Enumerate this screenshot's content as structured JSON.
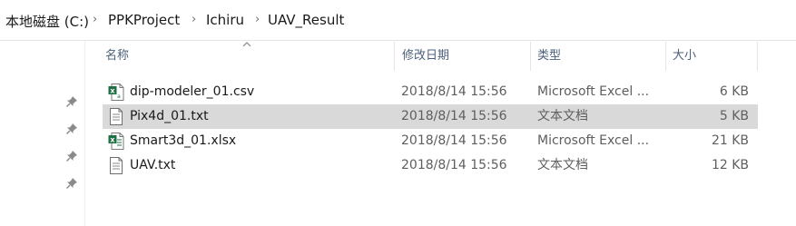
{
  "breadcrumb": {
    "items": [
      "本地磁盘 (C:)",
      "PPKProject",
      "Ichiru",
      "UAV_Result"
    ]
  },
  "columns": {
    "name": "名称",
    "date": "修改日期",
    "type": "类型",
    "size": "大小"
  },
  "files": [
    {
      "name": "dip-modeler_01.csv",
      "date": "2018/8/14 15:56",
      "type": "Microsoft Excel ...",
      "size": "6 KB",
      "icon": "excel-csv-icon"
    },
    {
      "name": "Pix4d_01.txt",
      "date": "2018/8/14 15:56",
      "type": "文本文档",
      "size": "5 KB",
      "icon": "text-file-icon",
      "selected": true
    },
    {
      "name": "Smart3d_01.xlsx",
      "date": "2018/8/14 15:56",
      "type": "Microsoft Excel ...",
      "size": "21 KB",
      "icon": "excel-xlsx-icon"
    },
    {
      "name": "UAV.txt",
      "date": "2018/8/14 15:56",
      "type": "文本文档",
      "size": "12 KB",
      "icon": "text-file-icon"
    }
  ],
  "icons": {
    "breadcrumb_separator": "chevron-right-icon",
    "quick_access": "pin-icon",
    "sort": "sort-ascending-icon"
  },
  "colors": {
    "header_text": "#4c607a",
    "selected_row": "#d9d9d9",
    "excel_green": "#1e7145"
  }
}
